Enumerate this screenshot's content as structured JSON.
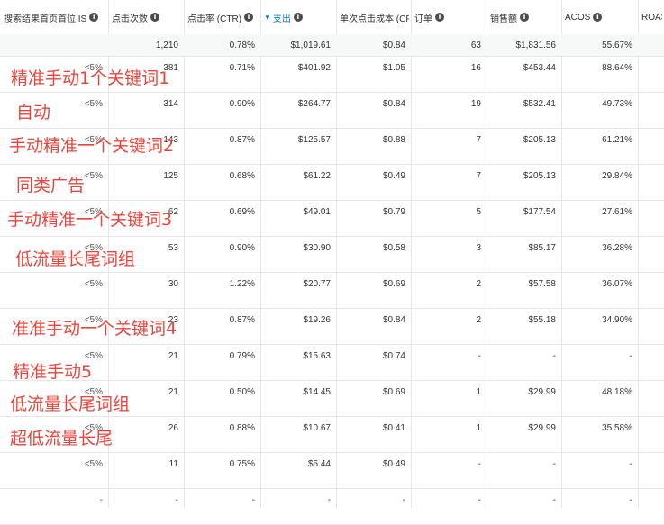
{
  "columns": [
    {
      "label": "搜索结果首页首位 IS",
      "info": true
    },
    {
      "label": "点击次数",
      "info": true
    },
    {
      "label": "点击率 (CTR)",
      "info": true
    },
    {
      "label": "支出",
      "info": true,
      "sorted": true
    },
    {
      "label": "单次点击成本 (CPC)",
      "info": false
    },
    {
      "label": "订单",
      "info": true
    },
    {
      "label": "销售额",
      "info": true
    },
    {
      "label": "ACOS",
      "info": true
    },
    {
      "label": "ROAS",
      "info": false
    }
  ],
  "totals": [
    "",
    "1,210",
    "0.78%",
    "$1,019.61",
    "$0.84",
    "63",
    "$1,831.56",
    "55.67%",
    ""
  ],
  "rows": [
    [
      "<5%",
      "381",
      "0.71%",
      "$401.92",
      "$1.05",
      "16",
      "$453.44",
      "88.64%",
      ""
    ],
    [
      "<5%",
      "314",
      "0.90%",
      "$264.77",
      "$0.84",
      "19",
      "$532.41",
      "49.73%",
      ""
    ],
    [
      "<5%",
      "143",
      "0.87%",
      "$125.57",
      "$0.88",
      "7",
      "$205.13",
      "61.21%",
      ""
    ],
    [
      "<5%",
      "125",
      "0.68%",
      "$61.22",
      "$0.49",
      "7",
      "$205.13",
      "29.84%",
      ""
    ],
    [
      "<5%",
      "62",
      "0.69%",
      "$49.01",
      "$0.79",
      "5",
      "$177.54",
      "27.61%",
      ""
    ],
    [
      "<5%",
      "53",
      "0.90%",
      "$30.90",
      "$0.58",
      "3",
      "$85.17",
      "36.28%",
      ""
    ],
    [
      "<5%",
      "30",
      "1.22%",
      "$20.77",
      "$0.69",
      "2",
      "$57.58",
      "36.07%",
      ""
    ],
    [
      "<5%",
      "23",
      "0.87%",
      "$19.26",
      "$0.84",
      "2",
      "$55.18",
      "34.90%",
      ""
    ],
    [
      "<5%",
      "21",
      "0.79%",
      "$15.63",
      "$0.74",
      "-",
      "-",
      "-",
      ""
    ],
    [
      "<5%",
      "21",
      "0.50%",
      "$14.45",
      "$0.69",
      "1",
      "$29.99",
      "48.18%",
      ""
    ],
    [
      "<5%",
      "26",
      "0.88%",
      "$10.67",
      "$0.41",
      "1",
      "$29.99",
      "35.58%",
      ""
    ],
    [
      "<5%",
      "11",
      "0.75%",
      "$5.44",
      "$0.49",
      "-",
      "-",
      "-",
      ""
    ],
    [
      "-",
      "-",
      "-",
      "-",
      "-",
      "-",
      "-",
      "-",
      ""
    ]
  ],
  "annotations": [
    "精准手动1个关键词1",
    "自动",
    "手动精准一个关键词2",
    "同类广告",
    "手动精准一个关键词3",
    "低流量长尾词组",
    "准准手动一个关键词4",
    "精准手动5",
    "低流量长尾词组",
    "超低流量长尾"
  ],
  "colors": {
    "annotation": "#e8453c",
    "sorted_header": "#0073bb",
    "totals_bg": "#f7f8f8",
    "grid": "#e7e7e7"
  }
}
